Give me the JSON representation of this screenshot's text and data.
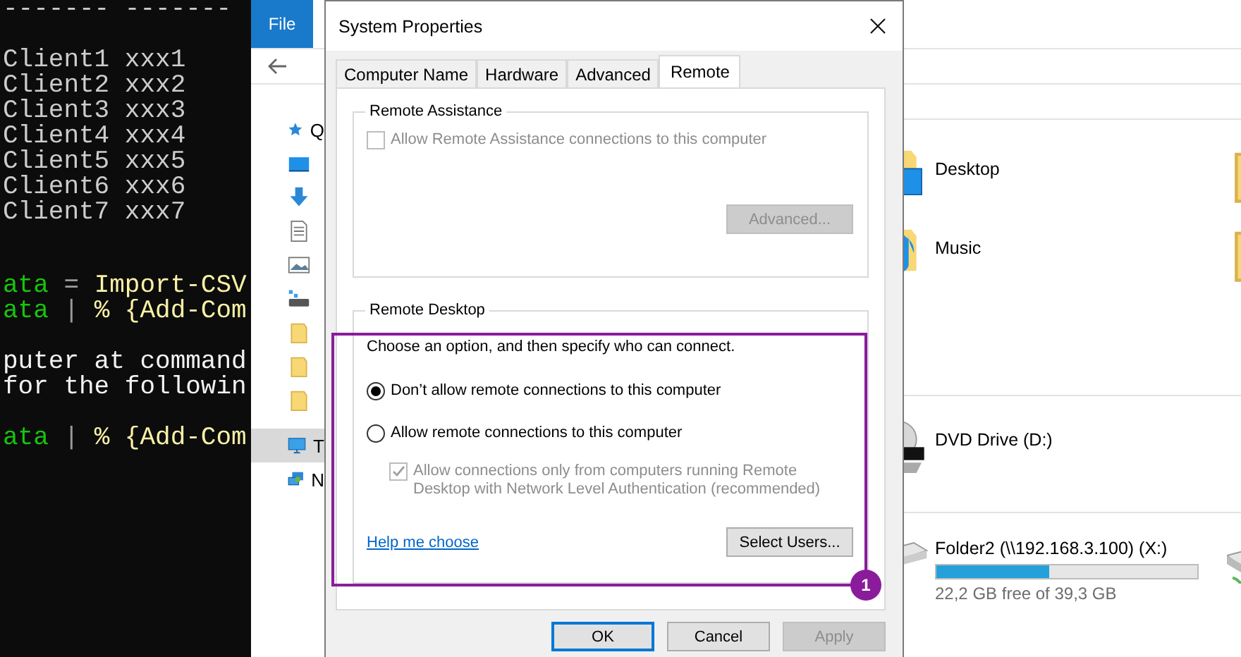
{
  "terminal": {
    "underline": {
      "text": "------- -------",
      "color": "#cccccc"
    },
    "blocks": [
      {
        "lines": [
          {
            "parts": [
              {
                "text": "Client1 xxx1",
                "color": "#cccccc"
              }
            ]
          },
          {
            "parts": [
              {
                "text": "Client2 xxx2",
                "color": "#cccccc"
              }
            ]
          },
          {
            "parts": [
              {
                "text": "Client3 xxx3",
                "color": "#cccccc"
              }
            ]
          },
          {
            "parts": [
              {
                "text": "Client4 xxx4",
                "color": "#cccccc"
              }
            ]
          },
          {
            "parts": [
              {
                "text": "Client5 xxx5",
                "color": "#cccccc"
              }
            ]
          },
          {
            "parts": [
              {
                "text": "Client6 xxx6",
                "color": "#cccccc"
              }
            ]
          },
          {
            "parts": [
              {
                "text": "Client7 xxx7",
                "color": "#cccccc"
              }
            ]
          }
        ]
      },
      {
        "lines": [
          {
            "parts": [
              {
                "text": "ata",
                "color": "#16c60c"
              },
              {
                "text": " = ",
                "color": "#9a9a9a"
              },
              {
                "text": "Import-CSV",
                "color": "#f9f1a5"
              }
            ]
          },
          {
            "parts": [
              {
                "text": "ata",
                "color": "#16c60c"
              },
              {
                "text": " | ",
                "color": "#9a9a9a"
              },
              {
                "text": "% {Add-Com",
                "color": "#f9f1a5"
              }
            ]
          }
        ]
      },
      {
        "lines": [
          {
            "parts": [
              {
                "text": "puter at command",
                "color": "#f2f2f2"
              }
            ]
          },
          {
            "parts": [
              {
                "text": "for the followin",
                "color": "#f2f2f2"
              }
            ]
          }
        ]
      },
      {
        "lines": [
          {
            "parts": [
              {
                "text": "ata",
                "color": "#16c60c"
              },
              {
                "text": " | ",
                "color": "#9a9a9a"
              },
              {
                "text": "% {Add-Com",
                "color": "#f9f1a5"
              }
            ]
          }
        ]
      }
    ]
  },
  "explorer": {
    "ribbon_tab": "File",
    "sidebar": [
      {
        "kind": "star",
        "label": "Q",
        "selected": false
      },
      {
        "kind": "desktop",
        "selected": false
      },
      {
        "kind": "download",
        "selected": false
      },
      {
        "kind": "document",
        "selected": false
      },
      {
        "kind": "pictures",
        "selected": false
      },
      {
        "kind": "netdrive",
        "selected": false
      },
      {
        "kind": "folder",
        "selected": false
      },
      {
        "kind": "folder",
        "selected": false
      },
      {
        "kind": "folder",
        "selected": false
      },
      {
        "kind": "pc",
        "label": "T",
        "selected": true
      },
      {
        "kind": "network",
        "label": "N",
        "selected": false
      }
    ],
    "folders": [
      {
        "name": "Desktop",
        "kind": "desktop"
      },
      {
        "name": "Music",
        "kind": "music"
      }
    ],
    "drives": [
      {
        "name": "DVD Drive (D:)",
        "kind": "dvd"
      },
      {
        "name": "Folder2 (\\\\192.168.3.100) (X:)",
        "kind": "netdrive",
        "level": 0.43,
        "free": "22,2 GB free of 39,3 GB"
      }
    ]
  },
  "dialog": {
    "title": "System Properties",
    "tabs": [
      {
        "label": "Computer Name",
        "selected": false
      },
      {
        "label": "Hardware",
        "selected": false
      },
      {
        "label": "Advanced",
        "selected": false
      },
      {
        "label": "Remote",
        "selected": true
      }
    ],
    "remote_assistance": {
      "title": "Remote Assistance",
      "checkbox": {
        "label": "Allow Remote Assistance connections to this computer",
        "checked": false,
        "disabled": true
      },
      "button": {
        "label": "Advanced...",
        "disabled": true
      }
    },
    "remote_desktop": {
      "title": "Remote Desktop",
      "instruction": "Choose an option, and then specify who can connect.",
      "options": [
        {
          "label": "Don’t allow remote connections to this computer",
          "selected": true
        },
        {
          "label": "Allow remote connections to this computer",
          "selected": false
        }
      ],
      "checkbox": {
        "label": "Allow connections only from computers running Remote Desktop with Network Level Authentication (recommended)",
        "checked": true,
        "disabled": true
      },
      "help_link": "Help me choose",
      "button": {
        "label": "Select Users...",
        "disabled": false
      }
    },
    "buttons": [
      {
        "label": "OK",
        "default": true,
        "disabled": false
      },
      {
        "label": "Cancel",
        "default": false,
        "disabled": false
      },
      {
        "label": "Apply",
        "default": false,
        "disabled": true
      }
    ]
  },
  "annotation": {
    "badge": "1"
  }
}
